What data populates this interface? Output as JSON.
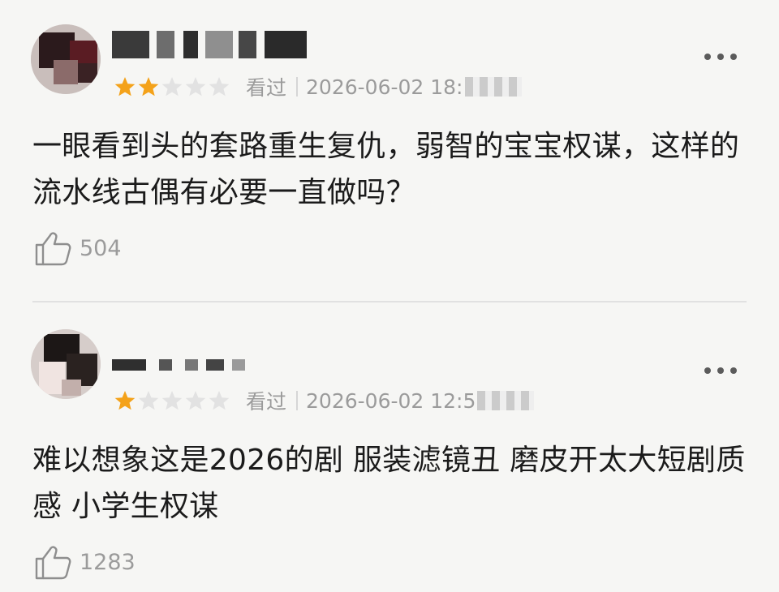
{
  "reviews": [
    {
      "rating": 2,
      "max_rating": 5,
      "watched_label": "看过",
      "time_visible": "2026-06-02 18:",
      "content": "一眼看到头的套路重生复仇，弱智的宝宝权谋，这样的流水线古偶有必要一直做吗？",
      "likes": "504"
    },
    {
      "rating": 1,
      "max_rating": 5,
      "watched_label": "看过",
      "time_visible": "2026-06-02 12:5",
      "content": "难以想象这是2026的剧 服装滤镜丑 磨皮开太大短剧质感 小学生权谋",
      "likes": "1283"
    }
  ],
  "colors": {
    "star_filled": "#f4a21a",
    "star_empty": "#e2e2e2",
    "text_primary": "#1b1b1b",
    "text_secondary": "#9b9b9b",
    "background": "#f6f6f4"
  },
  "icons": {
    "more": "more-dots-icon",
    "like": "thumbs-up-icon",
    "star": "star-icon"
  }
}
